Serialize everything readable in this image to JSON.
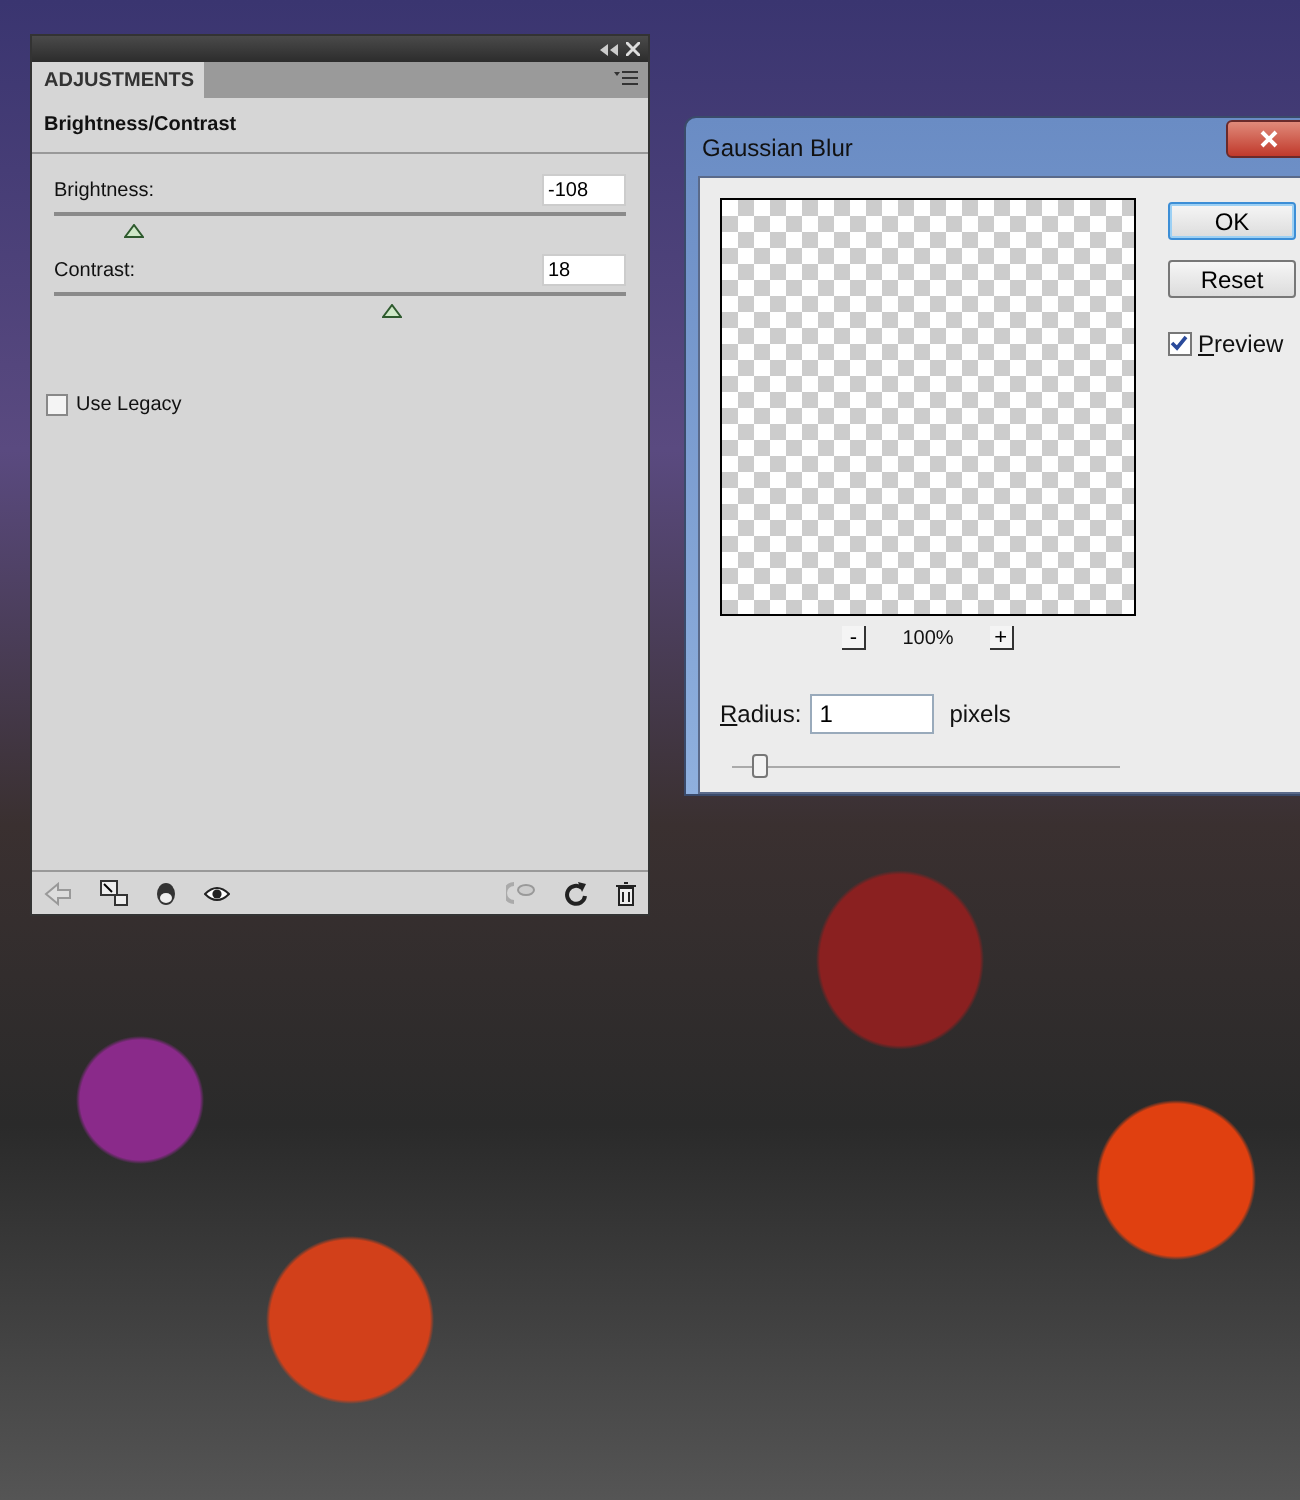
{
  "adjustments_panel": {
    "tab": "ADJUSTMENTS",
    "heading": "Brightness/Contrast",
    "sliders": [
      {
        "label": "Brightness:",
        "value": "-108",
        "level": 0.14
      },
      {
        "label": "Contrast:",
        "value": "18",
        "level": 0.59
      }
    ],
    "use_legacy": {
      "label": "Use Legacy",
      "checked": false
    }
  },
  "gaussian_blur": {
    "title": "Gaussian Blur",
    "zoom_out": "-",
    "zoom": "100%",
    "zoom_in": "+",
    "radius": {
      "label": "Radius:",
      "value": "1",
      "unit": "pixels",
      "level": 0.05
    },
    "buttons": [
      "OK",
      "Reset"
    ],
    "preview": {
      "label": "Preview",
      "checked": true
    }
  }
}
